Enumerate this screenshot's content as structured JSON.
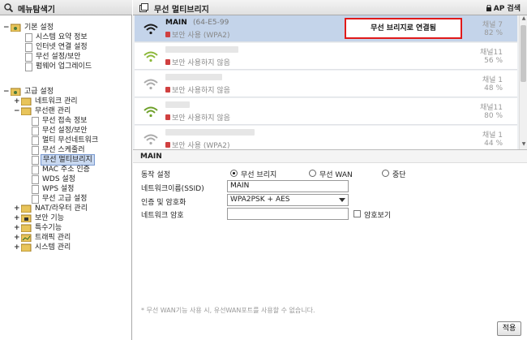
{
  "left_panel": {
    "title": "메뉴탐색기",
    "groups": [
      {
        "label": "기본 설정",
        "items": [
          "시스템 요약 정보",
          "인터넷 연결 설정",
          "무선 설정/보안",
          "펌웨어 업그레이드"
        ]
      },
      {
        "label": "고급 설정"
      }
    ],
    "advanced": {
      "network": "네트워크 관리",
      "wireless_lan": "무선랜 관리",
      "wireless_items": [
        "무선 접속 정보",
        "무선 설정/보안",
        "멀티 무선네트워크",
        "무선 스케줄러",
        "무선 멀티브리지",
        "MAC 주소 인증",
        "WDS 설정",
        "WPS 설정",
        "무선 고급 설정"
      ],
      "others": [
        "NAT/라우터 관리",
        "보안 기능",
        "특수기능",
        "트래픽 관리",
        "시스템 관리"
      ]
    },
    "selected_item": "무선 멀티브리지"
  },
  "right_panel": {
    "title": "무선 멀티브리지",
    "ap_search_label": "AP 검색",
    "connected_badge": "무선 브리지로 연결됨",
    "ap_list": [
      {
        "ssid": "MAIN",
        "mac": "(64-E5-99",
        "security": "보안 사용 (WPA2)",
        "channel": "채널 7",
        "signal": "82 %",
        "active": true,
        "signal_color": "#1a1a1a"
      },
      {
        "ssid": "",
        "mac": "",
        "security": "보안 사용하지 않음",
        "channel": "채널11",
        "signal": "56 %",
        "active": false,
        "signal_color": "#8cb83a"
      },
      {
        "ssid": "",
        "mac": "",
        "security": "보안 사용하지 않음",
        "channel": "채널 1",
        "signal": "48 %",
        "active": false,
        "signal_color": "#aaaaaa"
      },
      {
        "ssid": "",
        "mac": "",
        "security": "보안 사용하지 않음",
        "channel": "채널11",
        "signal": "80 %",
        "active": false,
        "signal_color": "#6ea02a"
      },
      {
        "ssid": "",
        "mac": "",
        "security": "보안 사용 (WPA2)",
        "channel": "채널 1",
        "signal": "44 %",
        "active": false,
        "signal_color": "#aaaaaa"
      }
    ],
    "form": {
      "section_title": "MAIN",
      "mode_label": "동작 설정",
      "mode_options": [
        "무선 브리지",
        "무선 WAN",
        "중단"
      ],
      "mode_selected": "무선 브리지",
      "ssid_label": "네트워크이름(SSID)",
      "ssid_value": "MAIN",
      "auth_label": "인증 및 암호화",
      "auth_value": "WPA2PSK + AES",
      "password_label": "네트워크 암호",
      "password_value": "",
      "show_password_label": "암호보기"
    },
    "note": "* 무선 WAN기능 사용 시, 유선WAN포트를 사용할 수 없습니다.",
    "apply_label": "적용"
  },
  "colors": {
    "accent_red": "#e01a1a",
    "selected_row": "#c4d4ea",
    "security_lock": "#d04040"
  }
}
